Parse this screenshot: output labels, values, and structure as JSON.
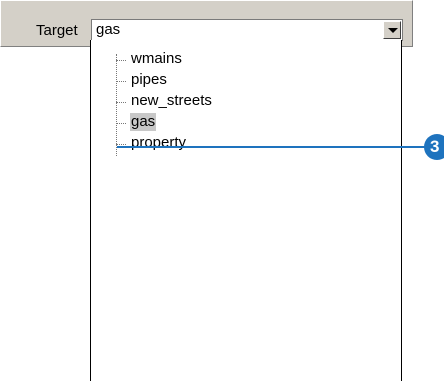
{
  "toolbar": {
    "target_label": "Target",
    "target_value": "gas"
  },
  "dropdown": {
    "items": [
      {
        "label": "wmains"
      },
      {
        "label": "pipes"
      },
      {
        "label": "new_streets"
      },
      {
        "label": "gas",
        "selected": true
      },
      {
        "label": "property"
      }
    ]
  },
  "callout": {
    "number": "3",
    "color": "#1e73be"
  },
  "icons": {
    "dropdown_button": "chevron-down-icon"
  }
}
